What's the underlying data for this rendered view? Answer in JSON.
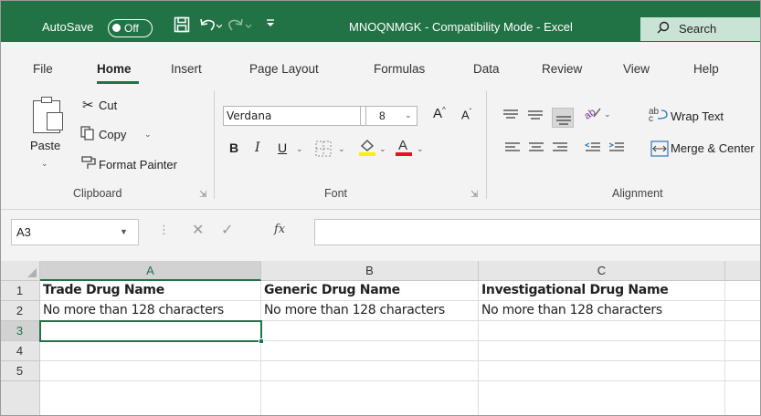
{
  "titlebar": {
    "autosave_label": "AutoSave",
    "toggle_label": "Off",
    "document_title": "MNOQNMGK  -  Compatibility Mode  -  Excel",
    "search_label": "Search"
  },
  "tabs": [
    "File",
    "Home",
    "Insert",
    "Page Layout",
    "Formulas",
    "Data",
    "Review",
    "View",
    "Help"
  ],
  "ribbon": {
    "clipboard": {
      "paste_label": "Paste",
      "cut_label": "Cut",
      "copy_label": "Copy",
      "format_painter_label": "Format Painter",
      "group_label": "Clipboard"
    },
    "font": {
      "font_name": "Verdana",
      "font_size": "8",
      "bold": "B",
      "italic": "I",
      "underline": "U",
      "grow": "A",
      "shrink": "A",
      "group_label": "Font"
    },
    "alignment": {
      "wrap_text_label": "Wrap Text",
      "merge_label": "Merge & Center",
      "group_label": "Alignment"
    }
  },
  "formula_bar": {
    "name_box": "A3",
    "fx_label": "fx",
    "formula": ""
  },
  "grid": {
    "columns": [
      "A",
      "B",
      "C"
    ],
    "rows": [
      "1",
      "2",
      "3",
      "4",
      "5"
    ],
    "cells": {
      "A1": "Trade Drug Name",
      "B1": "Generic Drug Name",
      "C1": "Investigational Drug Name",
      "A2": "No more than 128 characters",
      "B2": "No more than 128 characters",
      "C2": "No more than 128 characters"
    }
  },
  "colors": {
    "excel_green": "#217346",
    "ribbon_bg": "#f3f3f3"
  }
}
